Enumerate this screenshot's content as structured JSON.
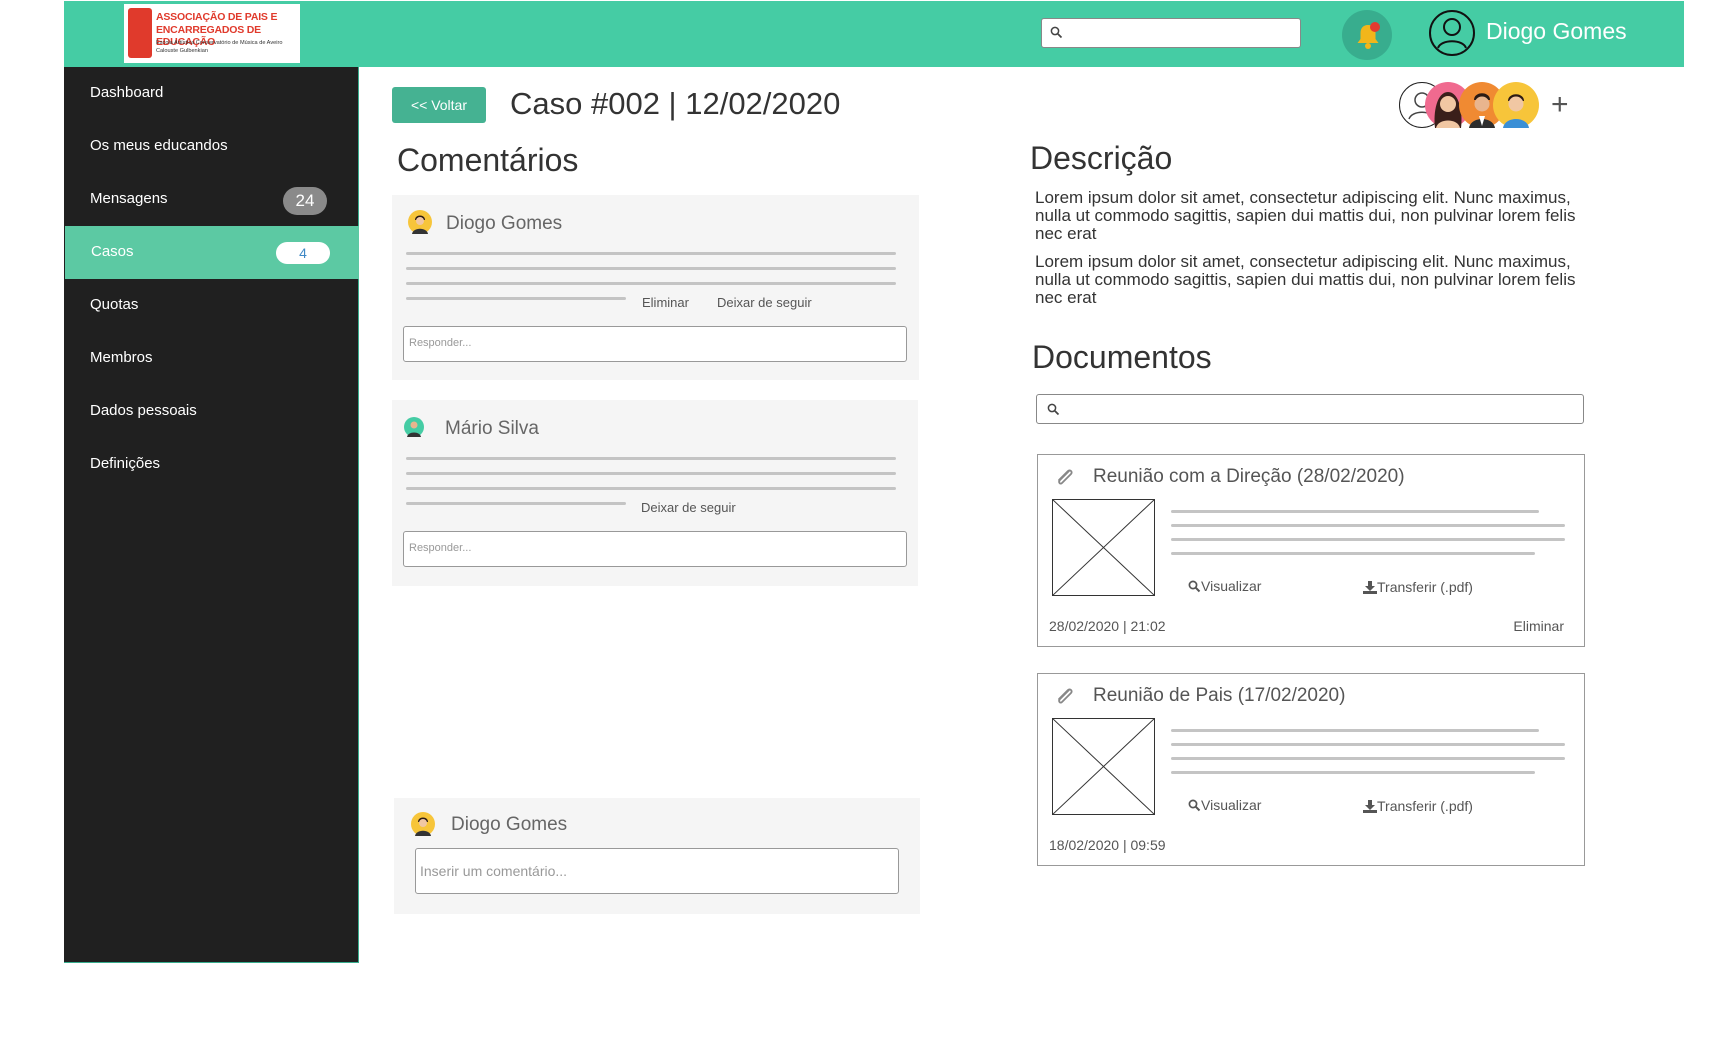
{
  "header": {
    "logo": {
      "line1": "ASSOCIAÇÃO DE PAIS E",
      "line2": "ENCARREGADOS DE EDUCAÇÃO",
      "line3": "Escola Artística Conservatório de Música de Aveiro",
      "line4": "Calouste Gulbenkian"
    },
    "search_placeholder": "",
    "username": "Diogo Gomes",
    "notification_dot": true
  },
  "sidebar": {
    "items": [
      {
        "label": "Dashboard"
      },
      {
        "label": "Os meus educandos"
      },
      {
        "label": "Mensagens",
        "badge": "24"
      },
      {
        "label": "Casos",
        "badge": "4",
        "active": true
      },
      {
        "label": "Quotas"
      },
      {
        "label": "Membros"
      },
      {
        "label": "Dados pessoais"
      },
      {
        "label": "Definições"
      }
    ]
  },
  "case": {
    "back_label": "<< Voltar",
    "title": "Caso #002 | 12/02/2020",
    "add_label": "+"
  },
  "comments": {
    "title": "Comentários",
    "items": [
      {
        "author": "Diogo Gomes",
        "delete_label": "Eliminar",
        "unfollow_label": "Deixar de seguir",
        "reply_placeholder": "Responder..."
      },
      {
        "author": "Mário Silva",
        "unfollow_label": "Deixar de seguir",
        "reply_placeholder": "Responder..."
      }
    ],
    "new_comment": {
      "author": "Diogo Gomes",
      "placeholder": "Inserir um comentário..."
    }
  },
  "description": {
    "title": "Descrição",
    "paragraphs": [
      "Lorem ipsum dolor sit amet, consectetur adipiscing elit. Nunc maximus, nulla ut commodo sagittis, sapien dui mattis dui, non pulvinar lorem felis nec erat",
      "Lorem ipsum dolor sit amet, consectetur adipiscing elit. Nunc maximus, nulla ut commodo sagittis, sapien dui mattis dui, non pulvinar lorem felis nec erat"
    ]
  },
  "documents": {
    "title": "Documentos",
    "search_placeholder": "",
    "items": [
      {
        "title": "Reunião com a Direção (28/02/2020)",
        "view_label": "Visualizar",
        "download_label": "Transferir (.pdf)",
        "date": "28/02/2020 | 21:02",
        "delete_label": "Eliminar"
      },
      {
        "title": "Reunião de Pais (17/02/2020)",
        "view_label": "Visualizar",
        "download_label": "Transferir (.pdf)",
        "date": "18/02/2020 | 09:59"
      }
    ]
  },
  "colors": {
    "brand": "#45cca4",
    "sidebar_bg": "#202020",
    "active_item": "#5cc9a3",
    "button": "#45b292"
  }
}
